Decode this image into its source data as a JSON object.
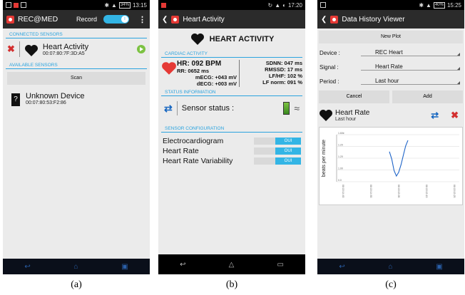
{
  "panel_a": {
    "status": {
      "battery": "34%",
      "time": "13:15"
    },
    "appbar": {
      "title": "REC@MED",
      "record_label": "Record",
      "toggle_state": "I"
    },
    "connected_header": "CONNECTED SENSORS",
    "connected": {
      "name": "Heart Activity",
      "mac": "00:07:80:7F:3D:A5"
    },
    "available_header": "AVAILABLE SENSORS",
    "scan_label": "Scan",
    "unknown": {
      "name": "Unknown Device",
      "mac": "00:07:80:53:F2:86"
    },
    "caption": "(a)"
  },
  "panel_b": {
    "status": {
      "time": "17:20"
    },
    "appbar": {
      "title": "Heart Activity"
    },
    "title": "HEART ACTIVITY",
    "cardiac_header": "CARDIAC ACTIVITY",
    "hr": "HR: 092 BPM",
    "rr": "RR: 0652 ms",
    "mecg": "mECG: +043 mV",
    "decg": "dECG: +003 mV",
    "sdnn": "SDNN: 047 ms",
    "rmssd": "RMSSD: 17 ms",
    "lfhf": "LF/HF: 102 %",
    "lfnorm": "LF norm: 091 %",
    "status_header": "STATUS INFORMATION",
    "sensor_status": "Sensor status :",
    "config_header": "SENSOR CONFIGURATION",
    "config": [
      {
        "label": "Electrocardiogram",
        "state": "OUI"
      },
      {
        "label": "Heart Rate",
        "state": "OUI"
      },
      {
        "label": "Heart Rate Variability",
        "state": "OUI"
      }
    ],
    "caption": "(b)"
  },
  "panel_c": {
    "status": {
      "battery": "40%",
      "time": "15:25"
    },
    "appbar": {
      "title": "Data History Viewer"
    },
    "new_plot_label": "New Plot",
    "device_label": "Device :",
    "device_value": "REC Heart",
    "signal_label": "Signal :",
    "signal_value": "Heart Rate",
    "period_label": "Period :",
    "period_value": "Last hour",
    "cancel_label": "Cancel",
    "add_label": "Add",
    "plot_title": "Heart Rate",
    "plot_subtitle": "Last hour",
    "caption": "(c)",
    "chart_data": {
      "type": "line",
      "ylabel": "beats per minute",
      "yticks": [
        "1.60e",
        "1.20",
        "1.20",
        "1.00",
        "0.0"
      ],
      "xticks": [
        "08:15:14:45",
        "08:15:14:55",
        "08:15:15:05",
        "08:15:15:15",
        "08:15:15:25"
      ],
      "x": [
        0,
        1,
        2,
        3,
        4,
        5,
        6,
        7,
        8
      ],
      "values": [
        112,
        104,
        92,
        86,
        90,
        98,
        108,
        118,
        124
      ]
    }
  }
}
